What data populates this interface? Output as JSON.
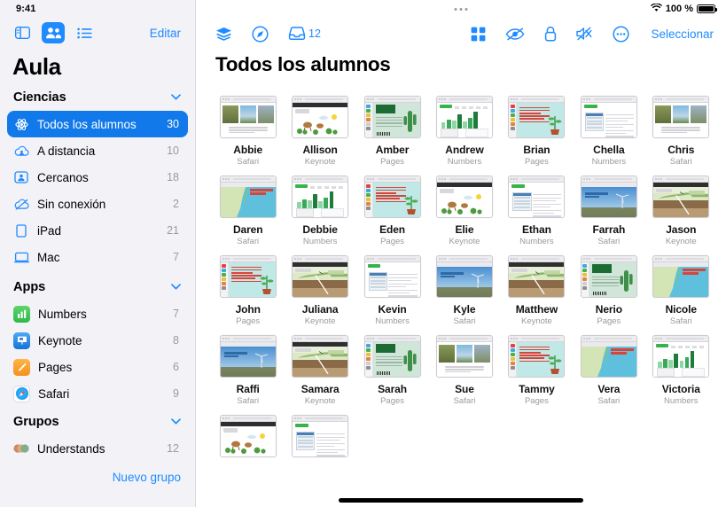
{
  "status": {
    "time": "9:41",
    "battery_percent": "100 %",
    "wifi_icon": "wifi-icon"
  },
  "sidebar": {
    "toolbar": {
      "sidebar_toggle_icon": "sidebar-toggle-icon",
      "people_view_icon": "people-view-icon",
      "list_view_icon": "list-view-icon",
      "edit_label": "Editar"
    },
    "title": "Aula",
    "sections": [
      {
        "id": "ciencias",
        "label": "Ciencias",
        "chevron": "chevron-down-icon",
        "items": [
          {
            "icon": "atom-icon",
            "label": "Todos los alumnos",
            "count": "30",
            "selected": true
          },
          {
            "icon": "cloud-person-icon",
            "label": "A distancia",
            "count": "10",
            "selected": false
          },
          {
            "icon": "person-badge-icon",
            "label": "Cercanos",
            "count": "18",
            "selected": false
          },
          {
            "icon": "cloud-slash-icon",
            "label": "Sin conexión",
            "count": "2",
            "selected": false
          },
          {
            "icon": "ipad-icon",
            "label": "iPad",
            "count": "21",
            "selected": false
          },
          {
            "icon": "mac-icon",
            "label": "Mac",
            "count": "7",
            "selected": false
          }
        ]
      },
      {
        "id": "apps",
        "label": "Apps",
        "chevron": "chevron-down-icon",
        "items": [
          {
            "icon": "numbers-app-icon",
            "label": "Numbers",
            "count": "7",
            "selected": false
          },
          {
            "icon": "keynote-app-icon",
            "label": "Keynote",
            "count": "8",
            "selected": false
          },
          {
            "icon": "pages-app-icon",
            "label": "Pages",
            "count": "6",
            "selected": false
          },
          {
            "icon": "safari-app-icon",
            "label": "Safari",
            "count": "9",
            "selected": false
          }
        ]
      },
      {
        "id": "grupos",
        "label": "Grupos",
        "chevron": "chevron-down-icon",
        "items": [
          {
            "icon": "group-avatars-icon",
            "label": "Understands",
            "count": "12",
            "selected": false
          }
        ]
      }
    ],
    "new_group_label": "Nuevo grupo"
  },
  "main": {
    "toolbar_left": [
      {
        "icon": "layers-icon",
        "label": ""
      },
      {
        "icon": "compass-navigate-icon",
        "label": ""
      },
      {
        "icon": "inbox-tray-icon",
        "label": "12"
      }
    ],
    "toolbar_right": [
      {
        "icon": "grid-layout-icon",
        "label": ""
      },
      {
        "icon": "eye-slash-icon",
        "label": ""
      },
      {
        "icon": "lock-icon",
        "label": ""
      },
      {
        "icon": "speaker-mute-icon",
        "label": ""
      },
      {
        "icon": "more-circle-icon",
        "label": ""
      }
    ],
    "select_label": "Seleccionar",
    "title": "Todos los alumnos",
    "students": [
      {
        "name": "Abbie",
        "app": "Safari",
        "art": "safari-wood"
      },
      {
        "name": "Allison",
        "app": "Keynote",
        "art": "animals"
      },
      {
        "name": "Amber",
        "app": "Pages",
        "art": "pages-cactus"
      },
      {
        "name": "Andrew",
        "app": "Numbers",
        "art": "numbers-chart"
      },
      {
        "name": "Brian",
        "app": "Pages",
        "art": "plant-poster"
      },
      {
        "name": "Chella",
        "app": "Numbers",
        "art": "doc-table"
      },
      {
        "name": "Chris",
        "app": "Safari",
        "art": "safari-wood"
      },
      {
        "name": "Daren",
        "app": "Safari",
        "art": "map-reef"
      },
      {
        "name": "Debbie",
        "app": "Numbers",
        "art": "numbers-chart"
      },
      {
        "name": "Eden",
        "app": "Pages",
        "art": "plant-poster"
      },
      {
        "name": "Elie",
        "app": "Keynote",
        "art": "animals"
      },
      {
        "name": "Ethan",
        "app": "Numbers",
        "art": "doc-table"
      },
      {
        "name": "Farrah",
        "app": "Safari",
        "art": "wind-energy"
      },
      {
        "name": "Jason",
        "app": "Keynote",
        "art": "geology"
      },
      {
        "name": "John",
        "app": "Pages",
        "art": "plant-poster"
      },
      {
        "name": "Juliana",
        "app": "Keynote",
        "art": "geology"
      },
      {
        "name": "Kevin",
        "app": "Numbers",
        "art": "doc-table"
      },
      {
        "name": "Kyle",
        "app": "Safari",
        "art": "wind-energy"
      },
      {
        "name": "Matthew",
        "app": "Keynote",
        "art": "geology"
      },
      {
        "name": "Nerio",
        "app": "Pages",
        "art": "pages-cactus"
      },
      {
        "name": "Nicole",
        "app": "Safari",
        "art": "map-reef"
      },
      {
        "name": "Raffi",
        "app": "Safari",
        "art": "wind-energy"
      },
      {
        "name": "Samara",
        "app": "Keynote",
        "art": "geology"
      },
      {
        "name": "Sarah",
        "app": "Pages",
        "art": "pages-cactus"
      },
      {
        "name": "Sue",
        "app": "Safari",
        "art": "safari-wood"
      },
      {
        "name": "Tammy",
        "app": "Pages",
        "art": "plant-poster"
      },
      {
        "name": "Vera",
        "app": "Safari",
        "art": "map-reef"
      },
      {
        "name": "Victoria",
        "app": "Numbers",
        "art": "numbers-chart"
      },
      {
        "name": "",
        "app": "",
        "art": "animals"
      },
      {
        "name": "",
        "app": "",
        "art": "doc-table"
      }
    ]
  },
  "colors": {
    "accent": "#1f8bff",
    "selected_row": "#1279ea",
    "sidebar_bg": "#f2f2f7",
    "secondary_text": "#9a9aa0"
  }
}
